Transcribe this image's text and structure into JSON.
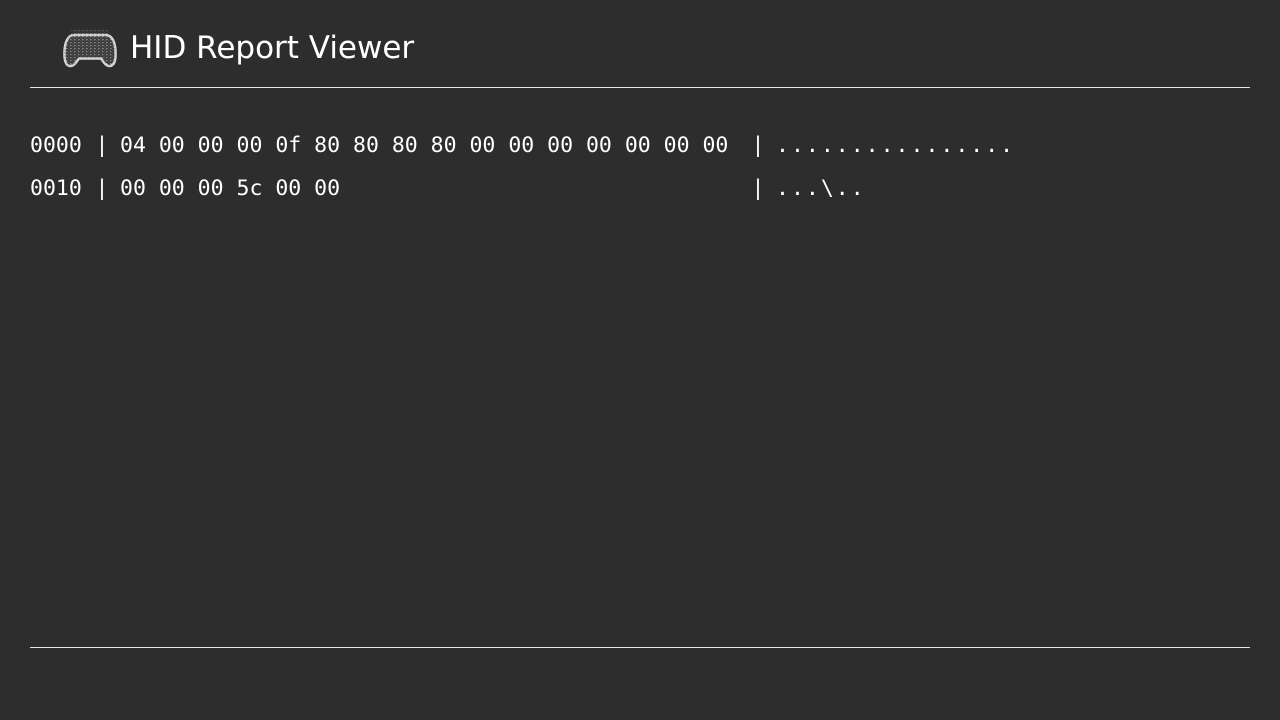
{
  "app": {
    "title": "HID Report Viewer",
    "icon": "gamepad-icon"
  },
  "colors": {
    "background": "#2d2d2d",
    "text": "#ffffff",
    "divider": "#e6e6e6"
  },
  "hexdump": {
    "separator": "|",
    "rows": [
      {
        "offset": "0000",
        "bytes": "04 00 00 00 0f 80 80 80 80 00 00 00 00 00 00 00",
        "ascii": "................"
      },
      {
        "offset": "0010",
        "bytes": "00 00 00 5c 00 00",
        "ascii": "...\\.."
      }
    ]
  }
}
